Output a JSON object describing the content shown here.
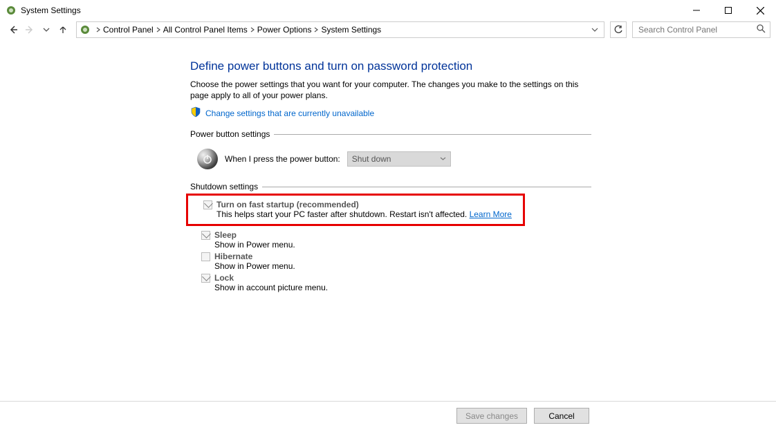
{
  "window": {
    "title": "System Settings"
  },
  "breadcrumbs": {
    "items": [
      "Control Panel",
      "All Control Panel Items",
      "Power Options",
      "System Settings"
    ]
  },
  "search": {
    "placeholder": "Search Control Panel"
  },
  "page": {
    "title": "Define power buttons and turn on password protection",
    "description": "Choose the power settings that you want for your computer. The changes you make to the settings on this page apply to all of your power plans.",
    "change_link": "Change settings that are currently unavailable"
  },
  "power_button_section": {
    "header": "Power button settings",
    "label": "When I press the power button:",
    "value": "Shut down"
  },
  "shutdown_section": {
    "header": "Shutdown settings",
    "items": [
      {
        "label": "Turn on fast startup (recommended)",
        "desc": "This helps start your PC faster after shutdown. Restart isn't affected. ",
        "link": "Learn More",
        "checked": true,
        "enabled": false,
        "highlight": true
      },
      {
        "label": "Sleep",
        "desc": "Show in Power menu.",
        "checked": true,
        "enabled": false
      },
      {
        "label": "Hibernate",
        "desc": "Show in Power menu.",
        "checked": false,
        "enabled": false
      },
      {
        "label": "Lock",
        "desc": "Show in account picture menu.",
        "checked": true,
        "enabled": false
      }
    ]
  },
  "footer": {
    "save": "Save changes",
    "cancel": "Cancel"
  }
}
